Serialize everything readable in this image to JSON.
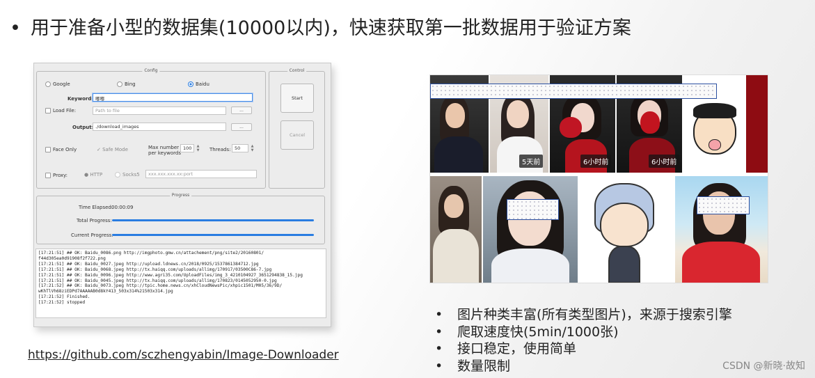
{
  "headline": {
    "bullet": "•",
    "text": "用于准备小型的数据集(10000以内)，快速获取第一批数据用于验证方案"
  },
  "app": {
    "config": {
      "title": "Config",
      "engines": [
        {
          "label": "Google",
          "selected": false
        },
        {
          "label": "Bing",
          "selected": false
        },
        {
          "label": "Baidu",
          "selected": true
        }
      ],
      "keywords_label": "Keywords:",
      "keywords_value": "嘟嘟",
      "load_file_label": "Load File:",
      "load_file_placeholder": "Path to file",
      "browse_label": "...",
      "output_label": "Output:",
      "output_value": "./download_images",
      "face_only_label": "Face Only",
      "safe_mode_label": "Safe Mode",
      "max_number_label_line1": "Max number",
      "max_number_label_line2": "per keywords",
      "max_number_value": "100",
      "threads_label": "Threads:",
      "threads_value": "50",
      "proxy_label": "Proxy:",
      "http_label": "HTTP",
      "socks_label": "Socks5",
      "proxy_placeholder": "xxx.xxx.xxx.xx:port"
    },
    "control": {
      "title": "Control",
      "start_label": "Start",
      "cancel_label": "Cancel"
    },
    "progress": {
      "title": "Progress",
      "time_elapsed_label": "Time Elapsed:",
      "time_elapsed_value": "00:00:09",
      "total_label": "Total Progress:",
      "total_value": 1.0,
      "current_label": "Current Progress:",
      "current_value": 1.0
    },
    "log": [
      "[17:21:51]  ## OK:  Baidu_0086.png  http://imgphoto.gmw.cn/attachement/png/site2/20160801/",
      "f44d305ea0d91908f2f722.png",
      "[17:21:51]  ## OK:  Baidu_0027.jpeg  http://upload.ldnews.cn/2018/0925/1537861384712.jpg",
      "[17:21:51]  ## OK:  Baidu_0068.jpeg  http://tx.haiqq.com/uploads/allimg/170917/03500C86-7.jpg",
      "[17:21:51]  ## OK:  Baidu_0096.jpeg  http://www.agri35.com/UploadFiles/img_3_4210104927_3651294838_15.jpg",
      "[17:21:51]  ## OK:  Baidu_0045.jpeg  http://tx.haiqq.com/uploads/allimg/170823/0145052950-0.jpg",
      "[17:21:52]  ## OK:  Baidu_0073.jpeg  http://tpic.home.news.cn/xhCloudNewsPic/xhpic1501/M05/36/9D/",
      "wKhTlVh68ziEDPd7AAAAAB0d8kY413_503x314%21503x314.jpg",
      "[17:21:52]  Finished.",
      "[17:21:52]  stopped"
    ]
  },
  "collage": {
    "badges": [
      "5天前",
      "6小时前",
      "6小时前"
    ]
  },
  "features": [
    "图片种类丰富(所有类型图片)，来源于搜索引擎",
    "爬取速度快(5min/1000张)",
    "接口稳定，使用简单",
    "数量限制"
  ],
  "repo_link": "https://github.com/sczhengyabin/Image-Downloader",
  "watermark": "CSDN @新晓·故知",
  "colors": {
    "accent": "#2a7de1",
    "mask_border": "#2a4fa0"
  }
}
